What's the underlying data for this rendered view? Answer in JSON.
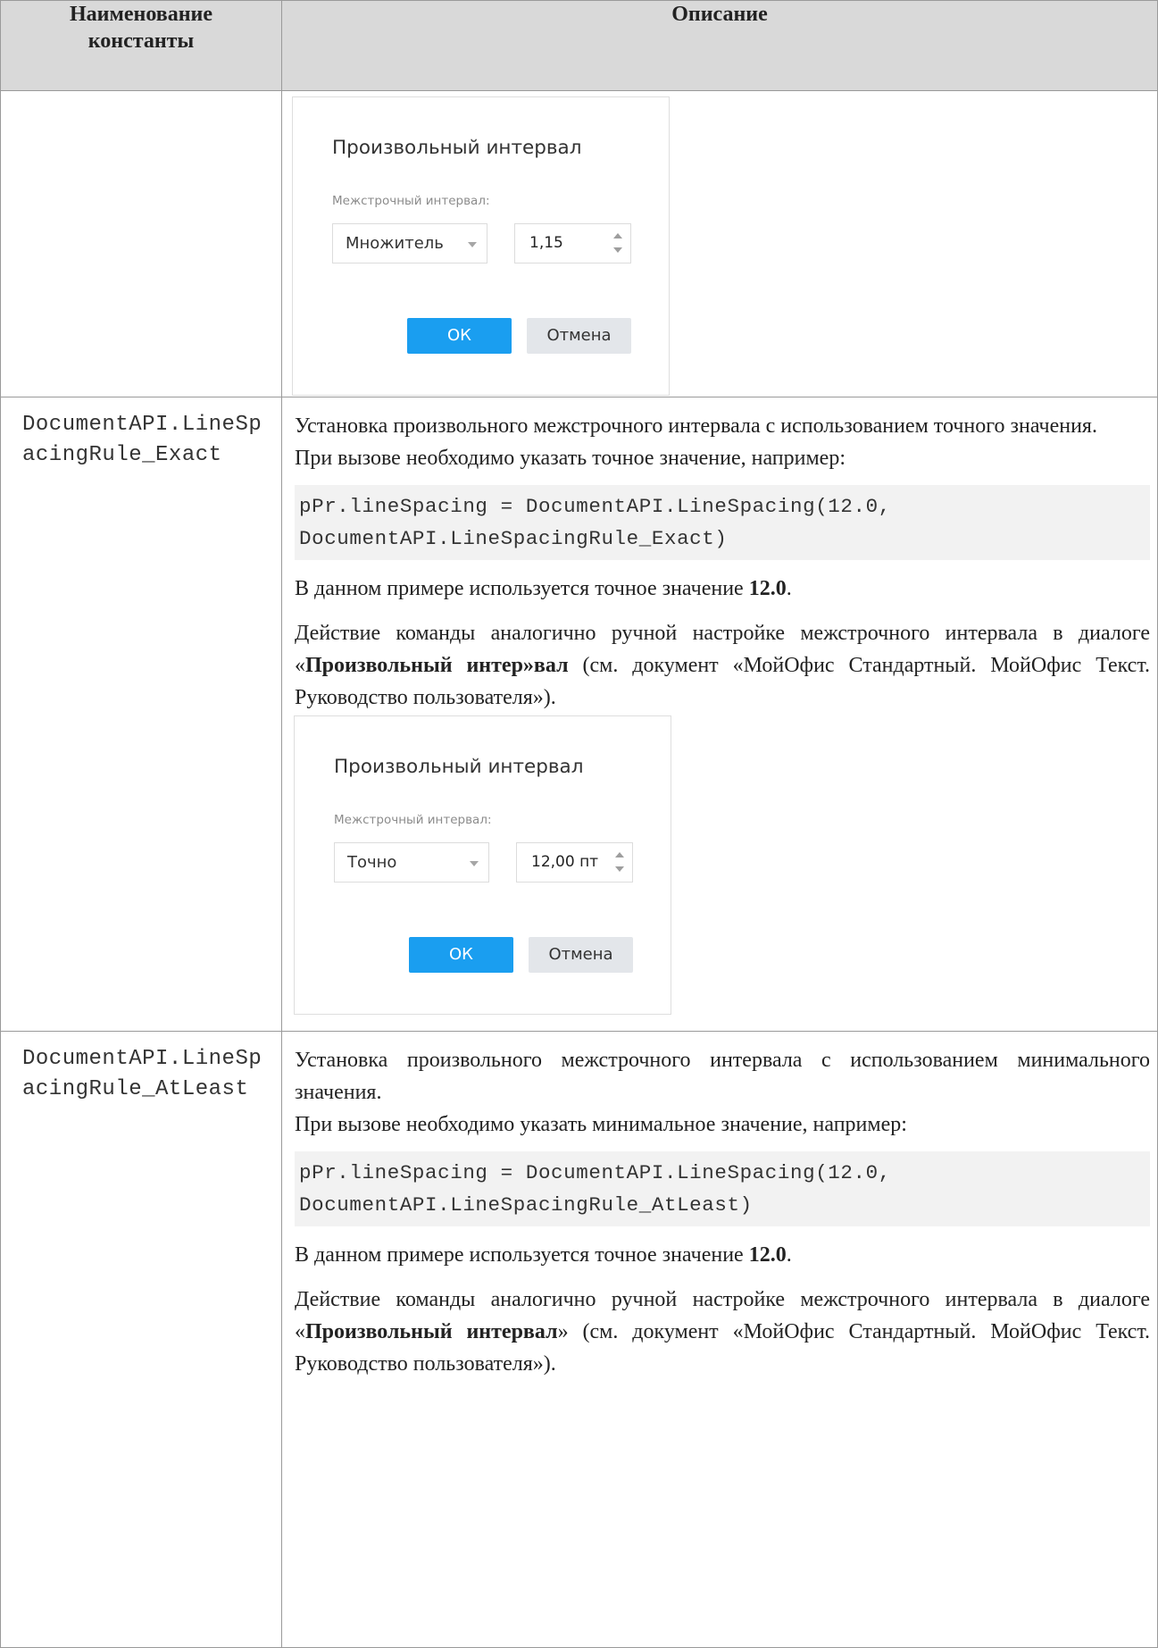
{
  "table": {
    "header": {
      "col1": "Наименование константы",
      "col2": "Описание"
    },
    "dialog_top": {
      "title": "Произвольный интервал",
      "label": "Межстрочный интервал:",
      "mode": "Множитель",
      "value": "1,15",
      "ok": "ОК",
      "cancel": "Отмена"
    },
    "row_exact": {
      "constant_line1": "DocumentAPI.LineSp",
      "constant_line2": "acingRule_Exact",
      "intro": "Установка произвольного межстрочного интервала с использованием точного значения.",
      "call_note": "При вызове необходимо указать точное значение, например:",
      "code_line1": "pPr.lineSpacing = DocumentAPI.LineSpacing(12.0,",
      "code_line2": "DocumentAPI.LineSpacingRule_Exact)",
      "example_prefix": "В данном примере используется точное значение ",
      "example_value": "12.0",
      "example_suffix": ".",
      "action_prefix": "Действие команды аналогично ручной настройке межстрочного интервала в диалоге «",
      "action_bold": "Произвольный интер»вал",
      "action_suffix": " (см. документ «МойОфис Стандартный. МойОфис Текст. Руководство пользователя»).",
      "dialog": {
        "title": "Произвольный интервал",
        "label": "Межстрочный интервал:",
        "mode": "Точно",
        "value": "12,00 пт",
        "ok": "ОК",
        "cancel": "Отмена"
      }
    },
    "row_atleast": {
      "constant_line1": "DocumentAPI.LineSp",
      "constant_line2": "acingRule_AtLeast",
      "intro": "Установка произвольного межстрочного интервала с использованием минимального значения.",
      "call_note": "При вызове необходимо указать минимальное значение, например:",
      "code_line1": "pPr.lineSpacing = DocumentAPI.LineSpacing(12.0,",
      "code_line2": "DocumentAPI.LineSpacingRule_AtLeast)",
      "example_prefix": "В данном примере используется точное значение ",
      "example_value": "12.0",
      "example_suffix": ".",
      "action_prefix": "Действие команды аналогично ручной настройке межстрочного интервала в диалоге «",
      "action_bold": "Произвольный интервал",
      "action_suffix": "» (см. документ «МойОфис Стандартный. МойОфис Текст. Руководство пользователя»)."
    }
  }
}
